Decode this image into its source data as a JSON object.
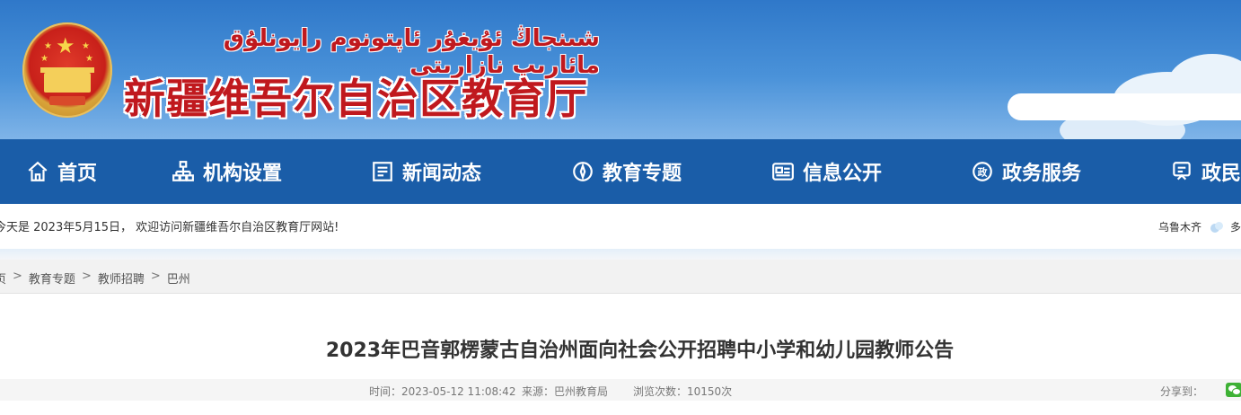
{
  "header": {
    "title_uyghur": "شىنجاڭ ئۇيغۇر ئاپتونوم رايونلۇق مائارىپ نازارىتى",
    "title_cn": "新疆维吾尔自治区教育厅",
    "search_placeholder": ""
  },
  "nav": {
    "items": [
      {
        "label": "首页",
        "icon": "home-icon"
      },
      {
        "label": "机构设置",
        "icon": "org-chart-icon"
      },
      {
        "label": "新闻动态",
        "icon": "news-icon"
      },
      {
        "label": "教育专题",
        "icon": "compass-icon"
      },
      {
        "label": "信息公开",
        "icon": "info-card-icon"
      },
      {
        "label": "政务服务",
        "icon": "gov-service-icon"
      },
      {
        "label": "政民",
        "icon": "interaction-icon"
      }
    ]
  },
  "welcome": {
    "text": "今天是 2023年5月15日， 欢迎访问新疆维吾尔自治区教育厅网站!",
    "city": "乌鲁木齐",
    "weather": "多"
  },
  "breadcrumb": {
    "items": [
      "页",
      "教育专题",
      "教师招聘",
      "巴州"
    ],
    "separator": ">"
  },
  "article": {
    "title": "2023年巴音郭楞蒙古自治州面向社会公开招聘中小学和幼儿园教师公告",
    "time": "时间：2023-05-12 11:08:42",
    "source": "来源：巴州教育局",
    "views": "浏览次数：10150次",
    "share_label": "分享到："
  },
  "colors": {
    "nav_bg": "#1a5da8",
    "title_red": "#c0191e",
    "banner_blue": "#2f78c9"
  }
}
